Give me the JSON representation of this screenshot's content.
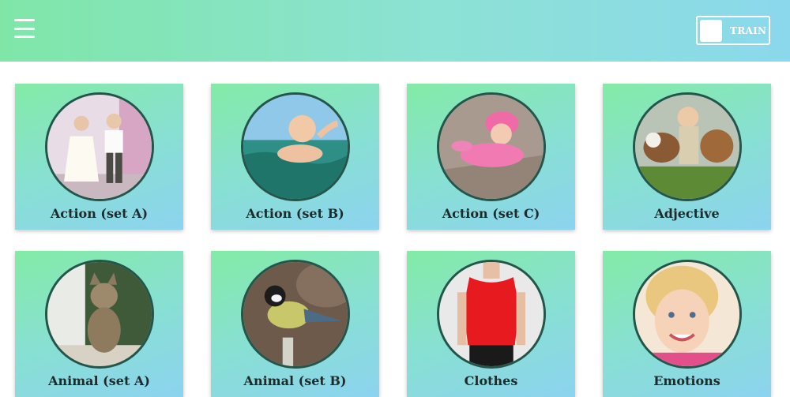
{
  "header": {
    "menu_icon": "hamburger-menu-icon",
    "train_label": "TRAIN",
    "gradient_start": "#7fe6a8",
    "gradient_end": "#8bd8ec"
  },
  "categories": [
    {
      "label": "Action (set A)",
      "image": "children-dancing"
    },
    {
      "label": "Action (set B)",
      "image": "baby-swimming"
    },
    {
      "label": "Action (set C)",
      "image": "baby-crawling"
    },
    {
      "label": "Adjective",
      "image": "boy-with-dogs"
    },
    {
      "label": "Animal (set A)",
      "image": "cat"
    },
    {
      "label": "Animal (set B)",
      "image": "bird"
    },
    {
      "label": "Clothes",
      "image": "red-blouse"
    },
    {
      "label": "Emotions",
      "image": "smiling-girl"
    }
  ],
  "colors": {
    "card_start": "#83eba6",
    "card_end": "#8cd3ef",
    "circle_border": "#24544a",
    "label_text": "#1f2a2a"
  }
}
